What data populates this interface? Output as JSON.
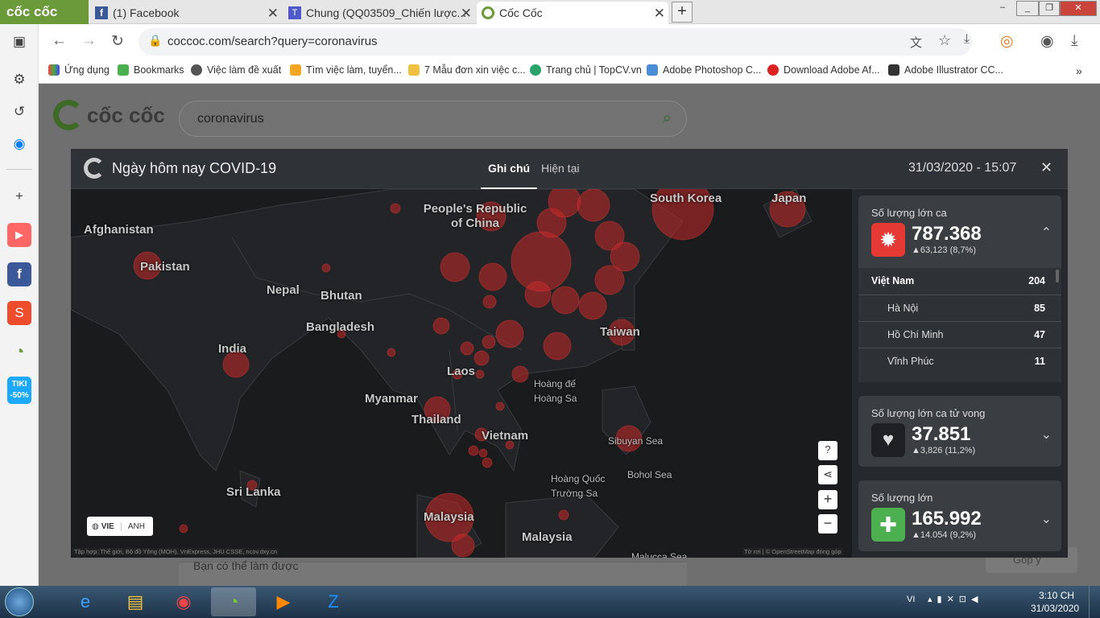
{
  "browser": {
    "logo_text": "cốc cốc",
    "tabs": [
      {
        "label": "(1) Facebook"
      },
      {
        "label": "Chung (QQ03509_Chiến lược..."
      },
      {
        "label": "Cốc Cốc"
      }
    ],
    "new_tab_label": "+",
    "url": "coccoc.com/search?query=coronavirus"
  },
  "bookmarks": [
    {
      "label": "Ứng dụng"
    },
    {
      "label": "Bookmarks"
    },
    {
      "label": "Việc làm đề xuất"
    },
    {
      "label": "Tìm việc làm, tuyển..."
    },
    {
      "label": "7 Mẫu đơn xin việc c..."
    },
    {
      "label": "Trang chủ | TopCV.vn"
    },
    {
      "label": "Adobe Photoshop C..."
    },
    {
      "label": "Download Adobe Af..."
    },
    {
      "label": "Adobe Illustrator CC..."
    }
  ],
  "sidebar": {
    "tiki_label": "TIKI -50%"
  },
  "page": {
    "logo_text": "cốc cốc",
    "search_value": "coronavirus",
    "under_text": "Bạn có thể làm được",
    "feedback_label": "Góp ý"
  },
  "modal": {
    "title": "Ngày hôm nay COVID-19",
    "tabs": [
      "Ghi chú",
      "Hiện tại"
    ],
    "datetime": "31/03/2020 - 15:07",
    "lang_options": [
      "VIE",
      "ANH"
    ],
    "attribution_left": "Tập hợp: Thế giới, Bộ đồ Yông (MOH), VnExpress, JHU CSSE, ncov.dxy.cn",
    "attribution_right": "Tờ rơi | © OpenStreetMap đóng góp",
    "map_labels": [
      "Afghanistan",
      "Pakistan",
      "Nepal",
      "Bhutan",
      "Bangladesh",
      "India",
      "People's Republic of China",
      "South Korea",
      "Japan",
      "Taiwan",
      "Myanmar",
      "Laos",
      "Thailand",
      "Vietnam",
      "Hoàng đế Hoàng Sa",
      "Sibuyan Sea",
      "Bohol Sea",
      "Hoàng Quốc Trường Sa",
      "Sri Lanka",
      "Malaysia",
      "Malaysia",
      "Malucca Sea"
    ],
    "cases": {
      "title": "Số lượng lớn ca",
      "value": "787.368",
      "delta": "▲63,123 (8,7%)",
      "country": "Việt Nam",
      "country_value": "204",
      "provinces": [
        {
          "name": "Hà Nội",
          "value": "85"
        },
        {
          "name": "Hồ Chí Minh",
          "value": "47"
        },
        {
          "name": "Vĩnh Phúc",
          "value": "11"
        }
      ]
    },
    "deaths": {
      "title": "Số lượng lớn ca tử vong",
      "value": "37.851",
      "delta": "▲3,826 (11,2%)"
    },
    "recovered": {
      "title": "Số lượng lớn",
      "value": "165.992",
      "delta": "▲14.054 (9,2%)"
    }
  },
  "taskbar": {
    "lang": "VI",
    "time": "3:10 CH",
    "date": "31/03/2020"
  }
}
